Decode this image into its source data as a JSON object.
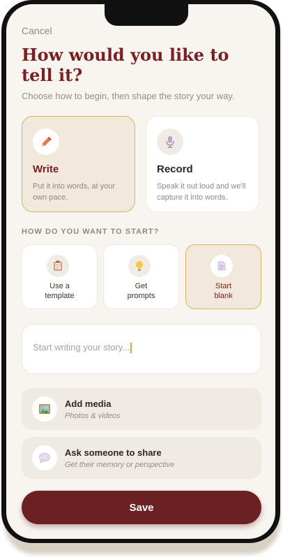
{
  "header": {
    "cancel_label": "Cancel",
    "title": "How would you like to tell it?",
    "subtitle": "Choose how to begin, then shape the story your way."
  },
  "modes": [
    {
      "title": "Write",
      "description": "Put it into words, at your own pace.",
      "icon": "pencil-icon",
      "selected": true
    },
    {
      "title": "Record",
      "description": "Speak it out loud and we'll capture it into words.",
      "icon": "microphone-icon",
      "selected": false
    }
  ],
  "start": {
    "section_label": "HOW DO YOU WANT TO START?",
    "options": [
      {
        "line1": "Use a",
        "line2": "template",
        "icon": "clipboard-icon",
        "selected": false
      },
      {
        "line1": "Get",
        "line2": "prompts",
        "icon": "lightbulb-icon",
        "selected": false
      },
      {
        "line1": "Start",
        "line2": "blank",
        "icon": "blank-page-icon",
        "selected": true
      }
    ]
  },
  "story": {
    "placeholder": "Start writing your story..."
  },
  "actions": [
    {
      "title": "Add media",
      "subtitle": "Photos & videos",
      "icon": "picture-icon"
    },
    {
      "title": "Ask someone to share",
      "subtitle": "Get their memory or perspective",
      "icon": "speech-bubble-icon"
    }
  ],
  "save_label": "Save",
  "colors": {
    "brand": "#6b2023",
    "title": "#7a1f22",
    "accent_border": "#d7b45a",
    "selected_bg": "#f2e8dc",
    "screen_bg": "#f8f5f0"
  }
}
